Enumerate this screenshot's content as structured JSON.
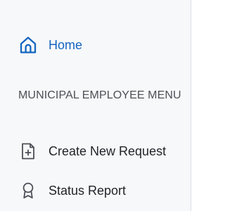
{
  "sidebar": {
    "home": {
      "label": "Home",
      "icon": "home-icon",
      "color": "#1565c0"
    },
    "section_heading": "MUNICIPAL EMPLOYEE MENU",
    "items": [
      {
        "label": "Create New Request",
        "icon": "document-plus-icon"
      },
      {
        "label": "Status Report",
        "icon": "award-ribbon-icon"
      }
    ]
  },
  "colors": {
    "accent": "#1565c0",
    "text": "#1f2327",
    "muted": "#4b4f55",
    "panel_background": "#f7f8fa",
    "divider": "#d9dde3"
  }
}
